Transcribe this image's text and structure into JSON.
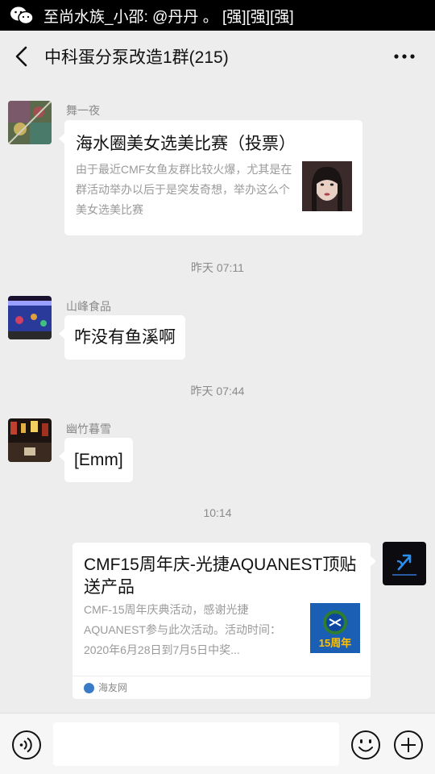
{
  "notification": {
    "text": "至尚水族_小邵: @丹丹 。 [强][强][强]"
  },
  "header": {
    "title": "中科蛋分泵改造1群(215)"
  },
  "messages": {
    "m1": {
      "sender": "舞一夜",
      "card_title": "海水圈美女选美比赛（投票）",
      "card_desc": "由于最近CMF女鱼友群比较火爆，尤其是在群活动举办以后于是突发奇想，举办这么个美女选美比赛"
    },
    "time1": "昨天 07:11",
    "m2": {
      "sender": "山峰食品",
      "text": "咋没有鱼溪啊"
    },
    "time2": "昨天 07:44",
    "m3": {
      "sender": "幽竹暮雪",
      "text": "[Emm]"
    },
    "time3": "10:14",
    "m4": {
      "card_title": "CMF15周年庆-光捷AQUANEST顶贴送产品",
      "card_desc": "CMF-15周年庆典活动，感谢光捷AQUANEST参与此次活动。活动时间：2020年6月28日到7月5日中奖...",
      "source": "海友网",
      "thumb_label": "15周年"
    }
  },
  "colors": {
    "background": "#ededed",
    "bubble": "#ffffff",
    "meta_text": "#8a8a8a"
  }
}
